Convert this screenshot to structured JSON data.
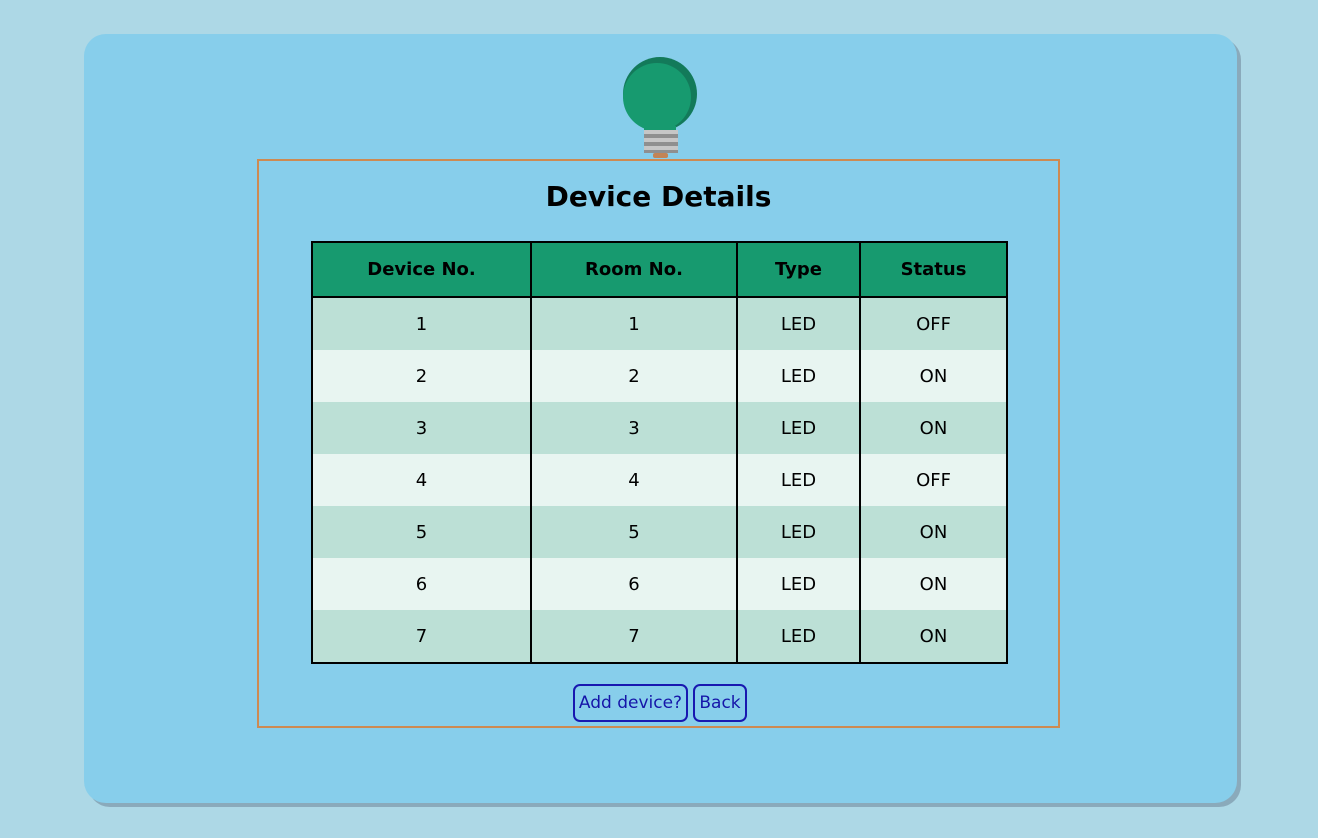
{
  "page": {
    "title": "Device Details"
  },
  "table": {
    "headers": [
      "Device No.",
      "Room No.",
      "Type",
      "Status"
    ],
    "rows": [
      [
        "1",
        "1",
        "LED",
        "OFF"
      ],
      [
        "2",
        "2",
        "LED",
        "ON"
      ],
      [
        "3",
        "3",
        "LED",
        "ON"
      ],
      [
        "4",
        "4",
        "LED",
        "OFF"
      ],
      [
        "5",
        "5",
        "LED",
        "ON"
      ],
      [
        "6",
        "6",
        "LED",
        "ON"
      ],
      [
        "7",
        "7",
        "LED",
        "ON"
      ]
    ]
  },
  "actions": {
    "add_label": "Add device?",
    "back_label": "Back"
  },
  "icons": {
    "logo": "lightbulb-icon"
  },
  "colors": {
    "background": "#add8e6",
    "card": "#87ceeb",
    "panel_border": "#cd8a52",
    "header": "#179a6f",
    "row_odd": "#bce0d6",
    "row_even": "#e8f5f1",
    "button_text": "#1515a8"
  }
}
